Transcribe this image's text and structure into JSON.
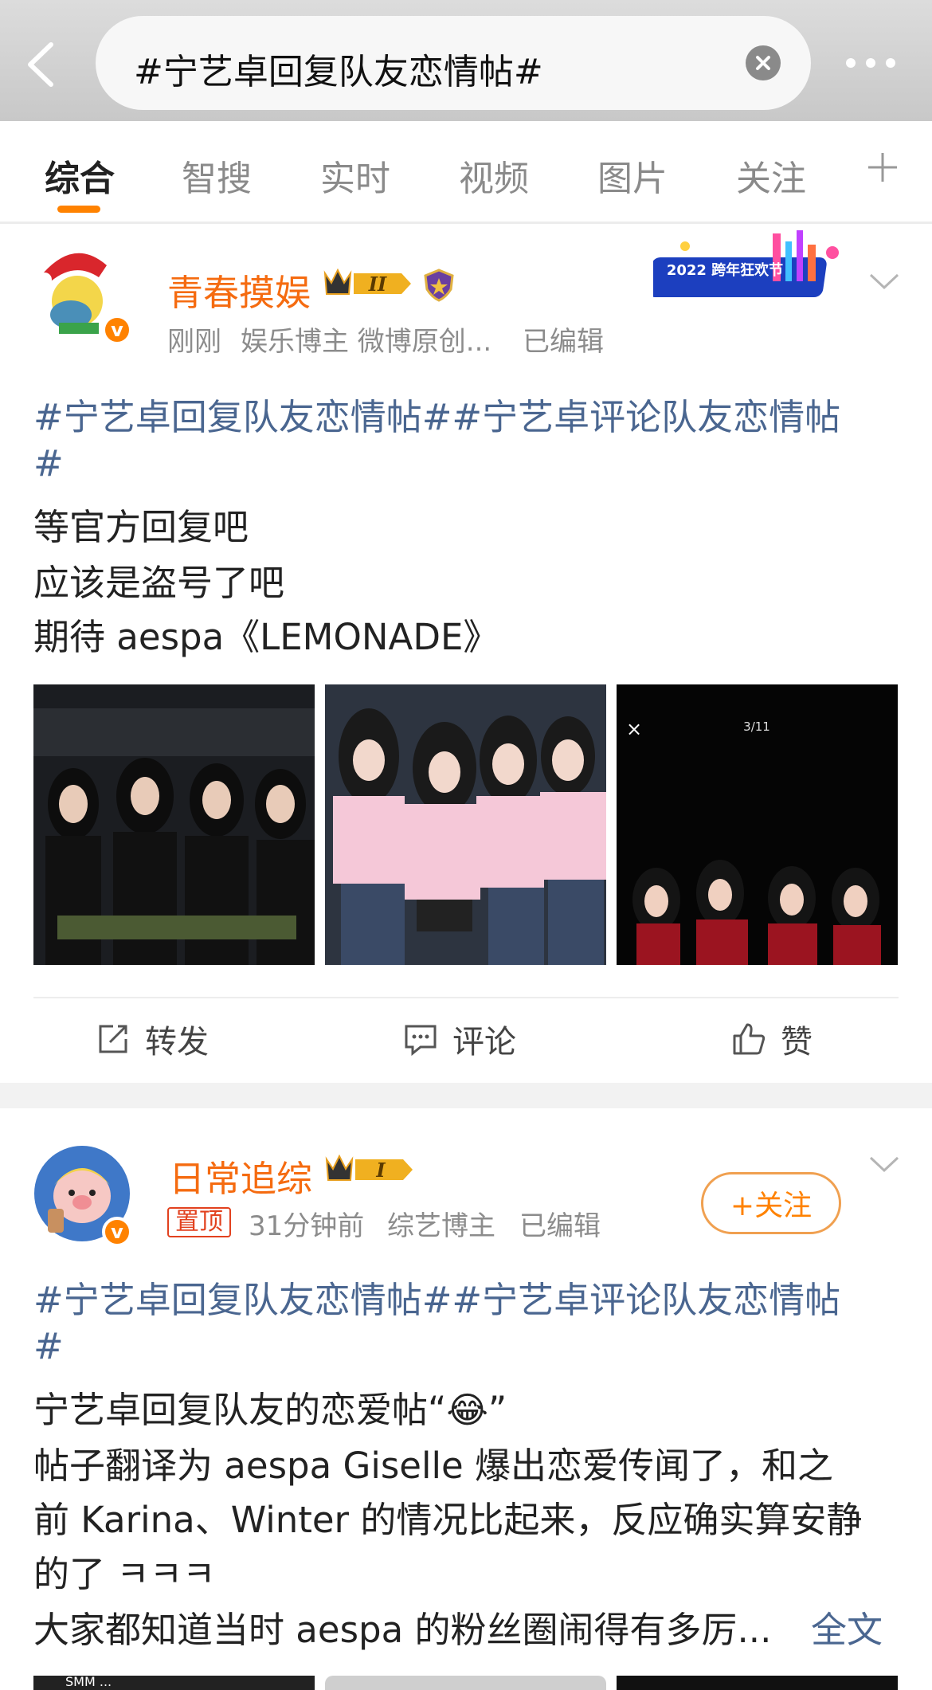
{
  "search": {
    "query": "#宁艺卓回复队友恋情帖#"
  },
  "tabs": [
    "综合",
    "智搜",
    "实时",
    "视频",
    "图片",
    "关注"
  ],
  "posts": [
    {
      "username": "青春摸娱",
      "level": "II",
      "time": "刚刚",
      "meta": "娱乐博主 微博原创...",
      "edited": "已编辑",
      "event_banner": "2022 跨年狂欢节",
      "lines": [
        "#宁艺卓回复队友恋情帖##宁艺卓评论队友恋情帖",
        "#",
        "等官方回复吧",
        "应该是盗号了吧",
        "期待 aespa《LEMONADE》"
      ],
      "photo_overlay": {
        "close": "×",
        "counter": "3/11"
      },
      "actions": {
        "repost": "转发",
        "comment": "评论",
        "like": "赞"
      }
    },
    {
      "username": "日常追综",
      "level": "I",
      "pinned": "置顶",
      "time": "31分钟前",
      "meta": "综艺博主",
      "edited": "已编辑",
      "follow": "+关注",
      "lines": [
        "#宁艺卓回复队友恋情帖##宁艺卓评论队友恋情帖",
        "#",
        "宁艺卓回复队友的恋爱帖“😂”",
        "帖子翻译为 aespa Giselle 爆出恋爱传闻了，和之",
        "前 Karina、Winter 的情况比起来，反应确实算安静",
        "的了 ㅋㅋㅋ",
        "大家都知道当时 aespa 的粉丝圈闹得有多厉..."
      ],
      "full_text": "全文",
      "thumb_caption": "SMM ..."
    }
  ]
}
